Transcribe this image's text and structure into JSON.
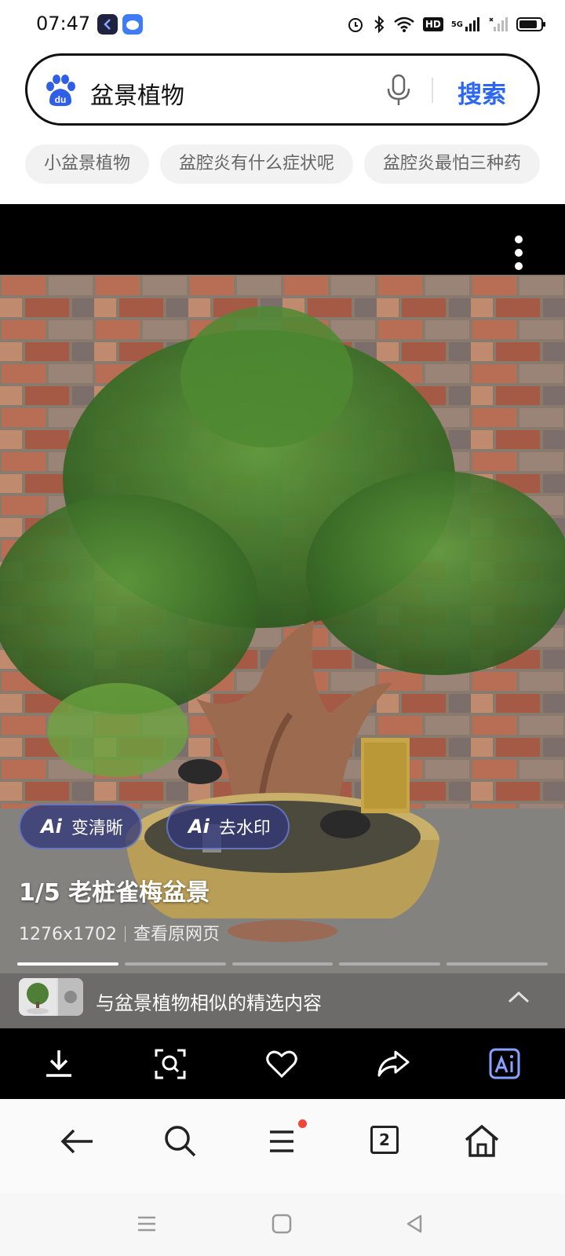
{
  "status_bar": {
    "time": "07:47",
    "icons": [
      "app-icon-dark",
      "app-icon-blue",
      "alarm-icon",
      "bluetooth-icon",
      "wifi-icon",
      "hd-icon",
      "signal-5g-icon",
      "signal-2-icon",
      "battery-icon"
    ],
    "hd_label": "HD",
    "net_label": "5G"
  },
  "search": {
    "query": "盆景植物",
    "button_label": "搜索",
    "logo_label": "du"
  },
  "suggestions": [
    "小盆景植物",
    "盆腔炎有什么症状呢",
    "盆腔炎最怕三种药"
  ],
  "viewer": {
    "ai_buttons": [
      {
        "mark": "Ai",
        "label": "变清晰"
      },
      {
        "mark": "Ai",
        "label": "去水印"
      }
    ],
    "title": "1/5 老桩雀梅盆景",
    "resolution": "1276x1702",
    "source_link": "查看原网页",
    "progress": {
      "current": 1,
      "total": 5
    },
    "similar_text": "与盆景植物相似的精选内容"
  },
  "toolbar": [
    "download-icon",
    "image-search-icon",
    "favorite-icon",
    "share-icon",
    "ai-image-icon"
  ],
  "bottom_nav": {
    "tab_count": "2",
    "items": [
      "back-icon",
      "search-icon",
      "menu-icon",
      "tabs-icon",
      "home-icon"
    ]
  },
  "colors": {
    "accent": "#2c67f2",
    "badge": "#f0453a"
  }
}
